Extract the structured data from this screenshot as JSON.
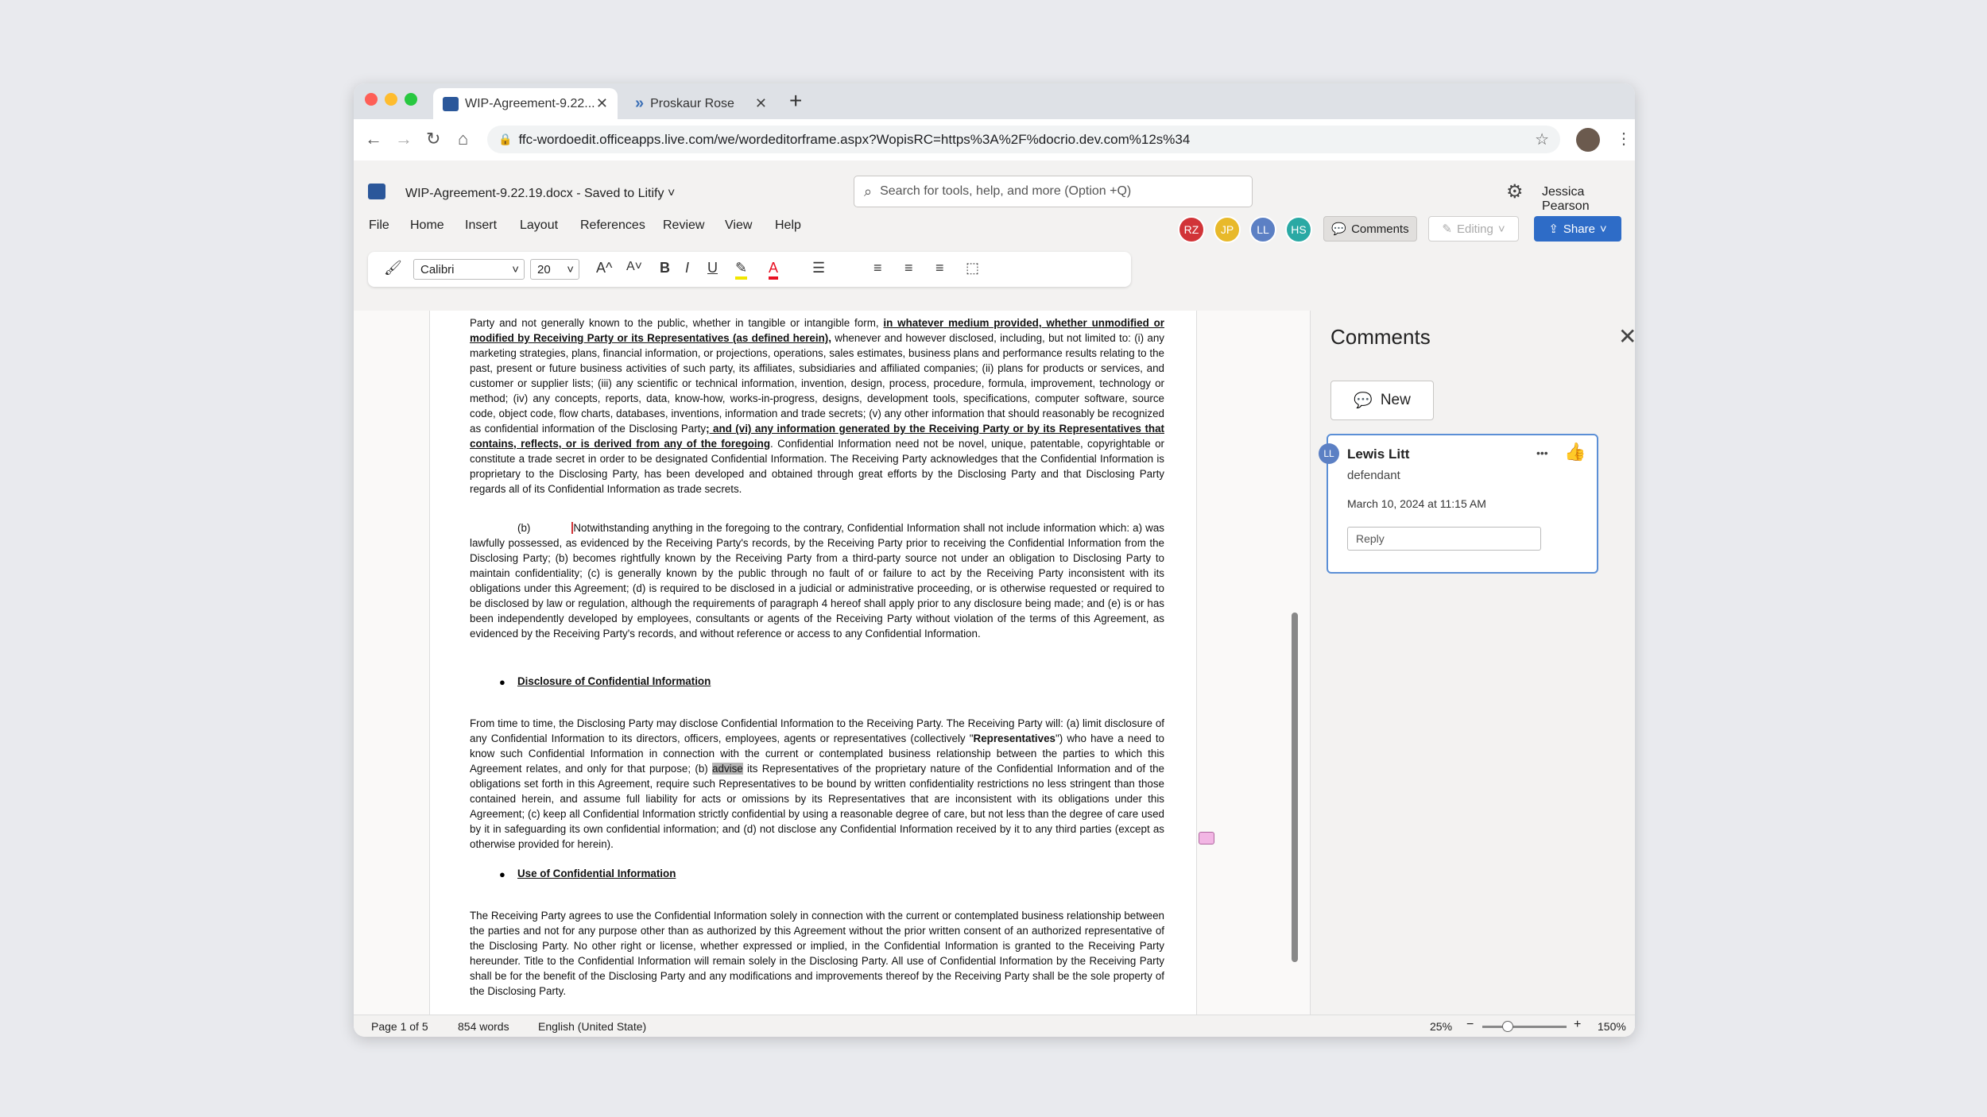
{
  "browser": {
    "tabs": [
      {
        "label": "WIP-Agreement-9.22...",
        "close": "✕"
      },
      {
        "label": "Proskaur Rose",
        "close": "✕"
      }
    ],
    "new_tab": "+",
    "url": "ffc-wordoedit.officeapps.live.com/we/wordeditorframe.aspx?WopisRC=https%3A%2F%docrio.dev.com%12s%34"
  },
  "header": {
    "doc_title": "WIP-Agreement-9.22.19.docx - Saved to Litify",
    "search_placeholder": "Search for tools, help, and more (Option +Q)",
    "user_name": "Jessica Pearson"
  },
  "menu": [
    "File",
    "Home",
    "Insert",
    "Layout",
    "References",
    "Review",
    "View",
    "Help"
  ],
  "collaborators": [
    {
      "initials": "RZ",
      "color": "#d13438"
    },
    {
      "initials": "JP",
      "color": "#e8b92a"
    },
    {
      "initials": "LL",
      "color": "#5c80c4"
    },
    {
      "initials": "HS",
      "color": "#2aa9a4"
    }
  ],
  "actions": {
    "comments": "Comments",
    "editing": "Editing",
    "share": "Share"
  },
  "ribbon": {
    "font": "Calibri",
    "size": "20",
    "grow": "A^",
    "shrink": "A˅",
    "bold": "B",
    "italic": "I",
    "underline": "U"
  },
  "document": {
    "p1_a": "Party and not generally known to the public, whether in tangible or intangible form, ",
    "p1_b": "in whatever medium provided, whether unmodified or modified by Receiving Party or its Representatives (as defined herein),",
    "p1_c": " whenever and however disclosed, including, but not limited to: (i) any marketing strategies, plans, financial information, or projections, operations, sales estimates, business plans and performance results relating to the past, present or future business activities of such party, its affiliates, subsidiaries and affiliated companies; (ii) plans for products or services, and customer or supplier lists; (iii) any scientific or technical information, invention, design, process, procedure, formula, improvement, technology or method; (iv) any concepts, reports, data, know-how, works-in-progress, designs, development tools, specifications, computer software, source code, object code, flow charts, databases, inventions, information and trade secrets; (v) any other information that should reasonably be recognized as confidential information of the Disclosing Party",
    "p1_d": "; and (vi) any information generated by the Receiving Party or by its Representatives that contains, reflects, or is derived from any of the foregoing",
    "p1_e": ". Confidential Information need not be novel, unique, patentable, copyrightable or constitute a trade secret in order to be designated Confidential Information. The Receiving Party acknowledges that the Confidential Information is proprietary to the Disclosing Party, has been developed and obtained through great efforts by the Disclosing Party and that Disclosing Party regards all of its Confidential Information as trade secrets.",
    "p2_label": "(b)",
    "p2": "Notwithstanding anything in the foregoing to the contrary, Confidential Information shall not include information which: a) was lawfully possessed, as evidenced by the Receiving Party's records, by the Receiving Party prior to receiving the Confidential Information from the Disclosing Party; (b) becomes rightfully known by the Receiving Party from a third-party source not under an obligation to Disclosing Party to maintain confidentiality; (c) is generally known by the public through no fault of or failure to act by the Receiving Party inconsistent with its obligations under this Agreement; (d) is required to be disclosed in a judicial or administrative proceeding, or is otherwise requested or required to be disclosed by law or regulation, although the requirements of paragraph 4 hereof shall apply prior to any disclosure being made; and (e) is or has been independently developed by employees, consultants or agents of the Receiving Party without violation of the terms of this Agreement, as evidenced by the Receiving Party's records, and without reference or access to any Confidential Information.",
    "heading1": "Disclosure of Confidential Information",
    "p3_a": "From time to time, the Disclosing Party may disclose Confidential Information to the Receiving Party. The Receiving Party will: (a) limit disclosure of any Confidential Information to its directors, officers, employees, agents or representatives (collectively \"",
    "p3_bold": "Representatives",
    "p3_b": "\") who have a need to know such Confidential Information in connection with the current or contemplated business relationship between the parties to which this Agreement relates, and only for that purpose; (b) ",
    "p3_sel": "advise",
    "p3_c": " its Representatives of the proprietary nature of the Confidential Information and of the obligations set forth in this Agreement, require such Representatives to be bound by written confidentiality restrictions no less stringent than those contained herein, and assume full liability for acts or omissions by its Representatives that are inconsistent with its obligations under this Agreement; (c) keep all Confidential Information strictly confidential by using a reasonable degree of care, but not less than the degree of care used by it in safeguarding its own confidential information; and (d) not disclose any Confidential Information received by it to any third parties (except as otherwise provided for herein).",
    "heading2": "Use of Confidential Information",
    "p4": "The Receiving Party agrees to use the Confidential Information solely in connection with the current or contemplated business relationship between the parties and not for any purpose other than as authorized by this Agreement without the prior written consent of an authorized representative of the Disclosing Party. No other right or license, whether expressed or implied, in the Confidential Information is granted to the Receiving Party hereunder. Title to the Confidential Information will remain solely in the Disclosing Party. All use of Confidential Information by the Receiving Party shall be for the benefit of the Disclosing Party and any modifications and improvements thereof by the Receiving Party shall be the sole property of the Disclosing Party."
  },
  "comments": {
    "title": "Comments",
    "new_label": "New",
    "items": [
      {
        "initials": "LL",
        "author": "Lewis Litt",
        "role": "defendant",
        "date": "March 10, 2024 at 11:15 AM",
        "reply_placeholder": "Reply",
        "more": "•••"
      }
    ]
  },
  "status": {
    "page": "Page 1 of 5",
    "words": "854 words",
    "language": "English (United State)",
    "zoom_min": "25%",
    "zoom_max": "150%",
    "zoom_level": 0.32
  }
}
